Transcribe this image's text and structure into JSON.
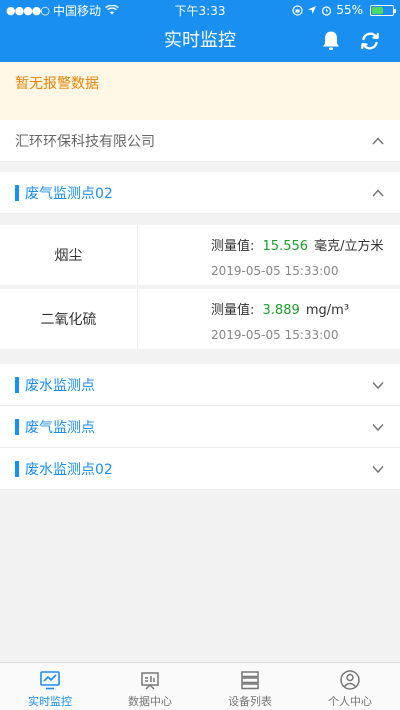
{
  "status": {
    "carrier": "中国移动",
    "time": "下午3:33",
    "battery": "55%",
    "battery_level": 0.55
  },
  "nav": {
    "title": "实时监控"
  },
  "alarm": {
    "message": "暂无报警数据"
  },
  "company": {
    "name": "汇环环保科技有限公司"
  },
  "groups": [
    {
      "name": "废气监测点02",
      "expanded": true,
      "rows": [
        {
          "pollutant": "烟尘",
          "label": "测量值:",
          "value": "15.556",
          "unit": "毫克/立方米",
          "time": "2019-05-05 15:33:00"
        },
        {
          "pollutant": "二氧化硫",
          "label": "测量值:",
          "value": "3.889",
          "unit": "mg/m³",
          "time": "2019-05-05 15:33:00"
        }
      ]
    },
    {
      "name": "废水监测点",
      "expanded": false
    },
    {
      "name": "废气监测点",
      "expanded": false
    },
    {
      "name": "废水监测点02",
      "expanded": false
    }
  ],
  "tabs": [
    {
      "label": "实时监控",
      "icon": "monitor-icon",
      "active": true
    },
    {
      "label": "数据中心",
      "icon": "chart-board-icon",
      "active": false
    },
    {
      "label": "设备列表",
      "icon": "server-list-icon",
      "active": false
    },
    {
      "label": "个人中心",
      "icon": "user-icon",
      "active": false
    }
  ],
  "colors": {
    "primary": "#1a8ff2",
    "alarm_text": "#e6850a",
    "alarm_bg": "#fff8e6",
    "value": "#1b9e2b"
  }
}
